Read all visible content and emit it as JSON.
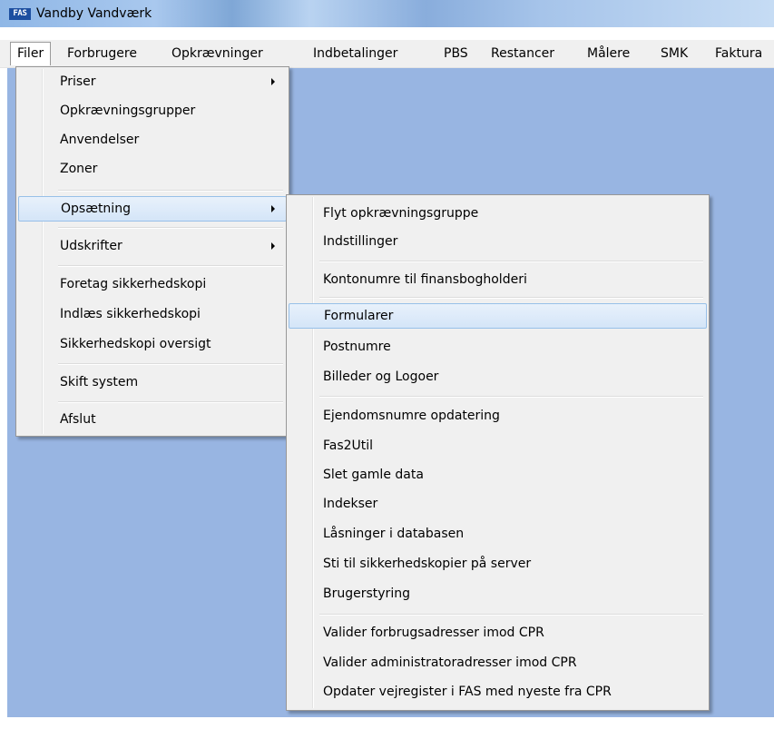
{
  "app": {
    "icon_text": "FAS",
    "title": "Vandby Vandværk"
  },
  "menubar": {
    "items": [
      "Filer",
      "Forbrugere",
      "Opkrævninger",
      "Indbetalinger",
      "PBS",
      "Restancer",
      "Målere",
      "SMK",
      "Faktura"
    ],
    "active": "Filer"
  },
  "filer_menu": {
    "items": [
      "Priser",
      "Opkrævningsgrupper",
      "Anvendelser",
      "Zoner",
      "Opsætning",
      "Udskrifter",
      "Foretag sikkerhedskopi",
      "Indlæs sikkerhedskopi",
      "Sikkerhedskopi oversigt",
      "Skift system",
      "Afslut"
    ],
    "highlighted": "Opsætning"
  },
  "opsaetning_menu": {
    "items": [
      "Flyt opkrævningsgruppe",
      "Indstillinger",
      "Kontonumre til finansbogholderi",
      "Formularer",
      "Postnumre",
      "Billeder og Logoer",
      "Ejendomsnumre opdatering",
      "Fas2Util",
      "Slet gamle data",
      "Indekser",
      "Låsninger i databasen",
      "Sti til sikkerhedskopier på server",
      "Brugerstyring",
      "Valider forbrugsadresser imod CPR",
      "Valider administratoradresser imod CPR",
      "Opdater vejregister i FAS med nyeste fra CPR"
    ],
    "highlighted": "Formularer"
  },
  "colors": {
    "workspace": "#98b5e2",
    "menu_bg": "#f0f0f0",
    "highlight_border": "#98c0e8"
  }
}
